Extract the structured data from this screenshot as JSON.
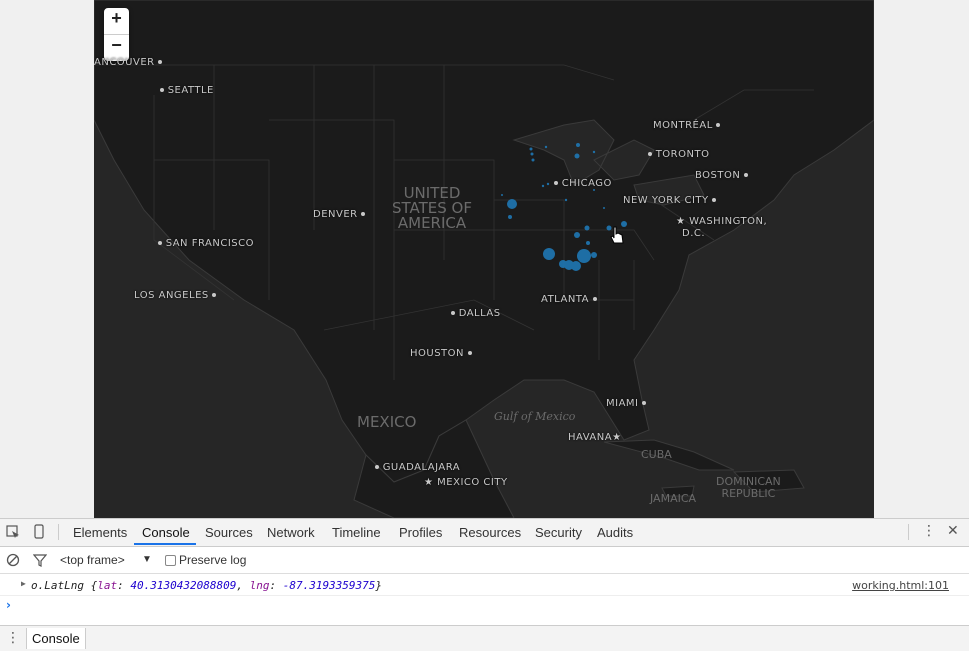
{
  "map": {
    "zoom_in": "+",
    "zoom_out": "−",
    "cities": [
      {
        "name": "ANCOUVER",
        "dot": "after"
      },
      {
        "name": "SEATTLE",
        "dot": "before"
      },
      {
        "name": "DENVER",
        "dot": "after"
      },
      {
        "name": "SAN FRANCISCO",
        "dot": "before"
      },
      {
        "name": "LOS ANGELES",
        "dot": "after"
      },
      {
        "name": "CHICAGO",
        "dot": "before"
      },
      {
        "name": "MONTRÉAL",
        "dot": "after"
      },
      {
        "name": "TORONTO",
        "dot": "before"
      },
      {
        "name": "BOSTON",
        "dot": "after"
      },
      {
        "name": "NEW YORK CITY",
        "dot": "after"
      },
      {
        "name": "WASHINGTON,",
        "dot": "none"
      },
      {
        "name": "D.C.",
        "dot": "none"
      },
      {
        "name": "DALLAS",
        "dot": "before"
      },
      {
        "name": "ATLANTA",
        "dot": "after"
      },
      {
        "name": "HOUSTON",
        "dot": "after"
      },
      {
        "name": "MIAMI",
        "dot": "after"
      },
      {
        "name": "HAVANA",
        "dot": "none"
      },
      {
        "name": "GUADALAJARA",
        "dot": "before"
      },
      {
        "name": "MEXICO CITY",
        "dot": "none"
      }
    ],
    "countries": [
      "UNITED",
      "STATES OF",
      "AMERICA",
      "MEXICO",
      "CUBA",
      "JAMAICA",
      "DOMINICAN",
      "REPUBLIC"
    ],
    "water": "Gulf of Mexico",
    "marker_color": "#1f78b4"
  },
  "devtools": {
    "tabs": [
      "Elements",
      "Console",
      "Sources",
      "Network",
      "Timeline",
      "Profiles",
      "Resources",
      "Security",
      "Audits"
    ],
    "active_tab": "Console",
    "frame": "<top frame>",
    "preserve_log": "Preserve log",
    "log": {
      "prefix": "o.LatLng {",
      "lat_key": "lat",
      "lat_val": "40.3130432088809",
      "lng_key": "lng",
      "lng_val": "-87.3193359375",
      "suffix": "}",
      "source": "working.html:101"
    },
    "drawer_tab": "Console"
  }
}
